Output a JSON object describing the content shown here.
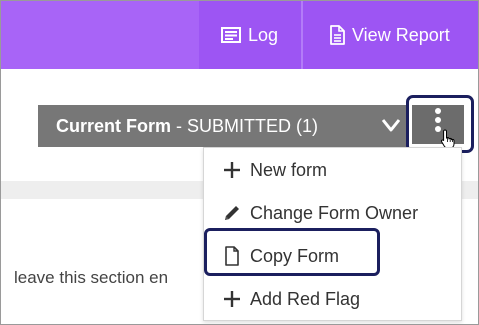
{
  "header": {
    "log_label": "Log",
    "view_report_label": "View Report"
  },
  "form_bar": {
    "title": "Current Form",
    "separator": " - ",
    "status": "SUBMITTED (1)"
  },
  "menu": {
    "items": [
      {
        "label": "New form",
        "icon": "plus-icon"
      },
      {
        "label": "Change Form Owner",
        "icon": "pencil-icon"
      },
      {
        "label": "Copy Form",
        "icon": "document-icon"
      },
      {
        "label": "Add Red Flag",
        "icon": "plus-icon"
      }
    ]
  },
  "body": {
    "section_text": "leave this section en"
  },
  "colors": {
    "header_purple": "#a25cf6",
    "form_bar_grey": "#777777",
    "highlight_navy": "#1b1f5e"
  }
}
